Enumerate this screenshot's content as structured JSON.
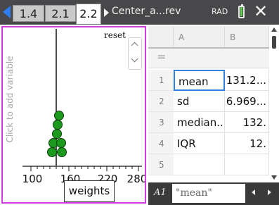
{
  "tabs": [
    {
      "label": "1.4"
    },
    {
      "label": "2.1"
    },
    {
      "label": "2.2",
      "active": true
    }
  ],
  "document_title": "Center_a...rev",
  "angle_mode": "RAD",
  "battery_level": 0.8,
  "left_panel": {
    "add_variable_text": "Click to add variable",
    "reset_label": "reset",
    "variable": "weights",
    "axis_ticks": [
      "100",
      "160",
      "220",
      "280"
    ],
    "dot_count": 6
  },
  "spreadsheet": {
    "columns": [
      "A",
      "B"
    ],
    "formula_row_symbol": "=",
    "rows": [
      {
        "num": "1",
        "a": "mean",
        "b": "131.2...",
        "selected": true
      },
      {
        "num": "2",
        "a": "sd",
        "b": "6.969..."
      },
      {
        "num": "3",
        "a": "median..",
        "b": "132."
      },
      {
        "num": "4",
        "a": "IQR",
        "b": "12."
      },
      {
        "num": "5",
        "a": "",
        "b": ""
      }
    ],
    "entry_ref": "A1",
    "entry_value": "\"mean\""
  },
  "colors": {
    "accent": "#d23be0",
    "selection": "#2f82e0",
    "dot_fill": "#1d9a1d",
    "tab_bar": "#48484a"
  }
}
